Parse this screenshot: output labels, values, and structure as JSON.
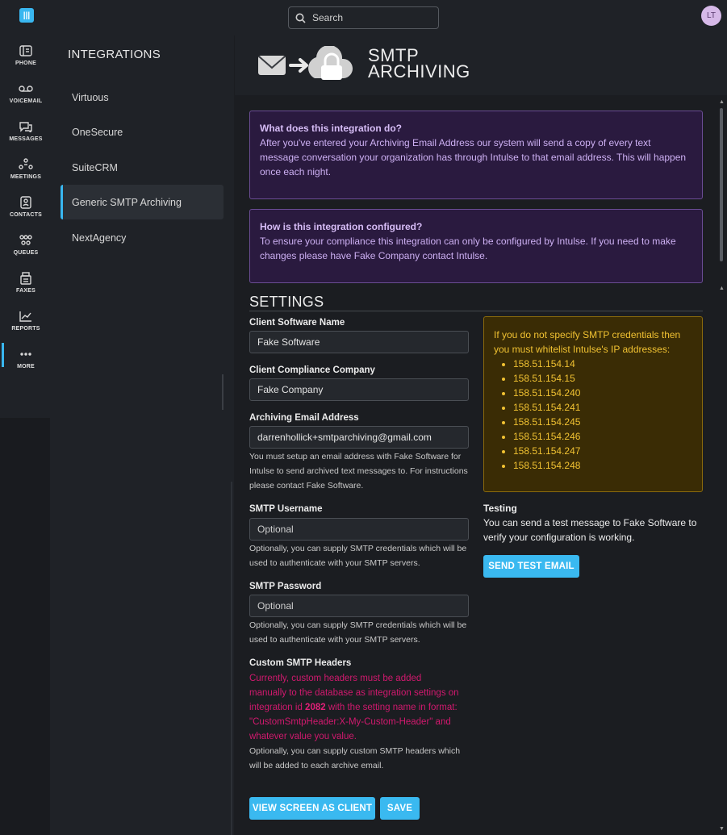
{
  "rail": {
    "items": [
      {
        "label": "PHONE"
      },
      {
        "label": "VOICEMAIL"
      },
      {
        "label": "MESSAGES"
      },
      {
        "label": "MEETINGS"
      },
      {
        "label": "CONTACTS"
      },
      {
        "label": "QUEUES"
      },
      {
        "label": "FAXES"
      },
      {
        "label": "REPORTS"
      },
      {
        "label": "MORE"
      }
    ]
  },
  "topbar": {
    "search_placeholder": "Search",
    "avatar_initials": "LT"
  },
  "integrations": {
    "title": "INTEGRATIONS",
    "items": [
      {
        "label": "Virtuous"
      },
      {
        "label": "OneSecure"
      },
      {
        "label": "SuiteCRM"
      },
      {
        "label": "Generic SMTP Archiving"
      },
      {
        "label": "NextAgency"
      }
    ]
  },
  "header": {
    "title_line1": "SMTP",
    "title_line2": "ARCHIVING"
  },
  "info1": {
    "question": "What does this integration do?",
    "text": "After you've entered your Archiving Email Address our system will send a copy of every text message conversation your organization has through Intulse to that email address. This will happen once each night."
  },
  "info2": {
    "question": "How is this integration configured?",
    "text": "To ensure your compliance this integration can only be configured by Intulse. If you need to make changes please have Fake Company contact Intulse."
  },
  "settings": {
    "title": "SETTINGS",
    "client_software_label": "Client Software Name",
    "client_software_value": "Fake Software",
    "compliance_label": "Client Compliance Company",
    "compliance_value": "Fake Company",
    "archive_email_label": "Archiving Email Address",
    "archive_email_value": "darrenhollick+smtparchiving@gmail.com",
    "archive_email_help": "You must setup an email address with Fake Software for Intulse to send archived text messages to. For instructions please contact Fake Software.",
    "smtp_user_label": "SMTP Username",
    "smtp_user_placeholder": "Optional",
    "smtp_user_help": "Optionally, you can supply SMTP credentials which will be used to authenticate with your SMTP servers.",
    "smtp_pass_label": "SMTP Password",
    "smtp_pass_placeholder": "Optional",
    "smtp_pass_help": "Optionally, you can supply SMTP credentials which will be used to authenticate with your SMTP servers.",
    "headers_label": "Custom SMTP Headers",
    "headers_warn_before": "Currently, custom headers must be added manually to the database as integration settings on integration id ",
    "headers_warn_id": "2082",
    "headers_warn_after": " with the setting name in format: \"CustomSmtpHeader:X-My-Custom-Header\" and whatever value you value.",
    "headers_help": "Optionally, you can supply custom SMTP headers which will be added to each archive email."
  },
  "ipbox": {
    "text": "If you do not specify SMTP credentials then you must whitelist Intulse's IP addresses:",
    "ips": [
      "158.51.154.14",
      "158.51.154.15",
      "158.51.154.240",
      "158.51.154.241",
      "158.51.154.245",
      "158.51.154.246",
      "158.51.154.247",
      "158.51.154.248"
    ]
  },
  "testing": {
    "title": "Testing",
    "text": "You can send a test message to Fake Software to verify your configuration is working.",
    "button": "SEND TEST EMAIL"
  },
  "footer_buttons": {
    "view_as_client": "VIEW SCREEN AS CLIENT",
    "save": "SAVE"
  },
  "colors": {
    "accent": "#3ab9f0",
    "info_bg": "#2a1a3f",
    "info_border": "#6a4c94",
    "warn_bg": "#3a2c05",
    "warn_text": "#f1c232",
    "error_text": "#d1196e"
  }
}
